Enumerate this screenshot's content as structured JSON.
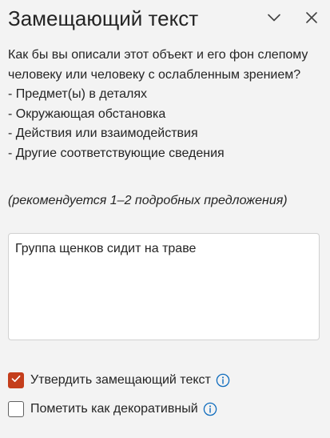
{
  "pane": {
    "title": "Замещающий текст",
    "collapse_icon": "chevron-down-icon",
    "close_icon": "close-icon"
  },
  "description": {
    "question": "Как бы вы описали этот объект и его фон слепому человеку или человеку с ослабленным зрением?",
    "bullets": [
      "- Предмет(ы) в деталях",
      "- Окружающая обстановка",
      "- Действия или взаимодействия",
      "- Другие соответствующие сведения"
    ]
  },
  "hint": "(рекомендуется 1–2 подробных предложения)",
  "alt_text": {
    "value": "Группа щенков сидит на траве"
  },
  "options": {
    "approve": {
      "label": "Утвердить замещающий текст",
      "checked": true,
      "info_icon": "info-icon"
    },
    "decorative": {
      "label": "Пометить как декоративный",
      "checked": false,
      "info_icon": "info-icon"
    }
  },
  "colors": {
    "accent": "#c43e1c",
    "info": "#0f6cbd",
    "background": "#f3f3f3"
  }
}
